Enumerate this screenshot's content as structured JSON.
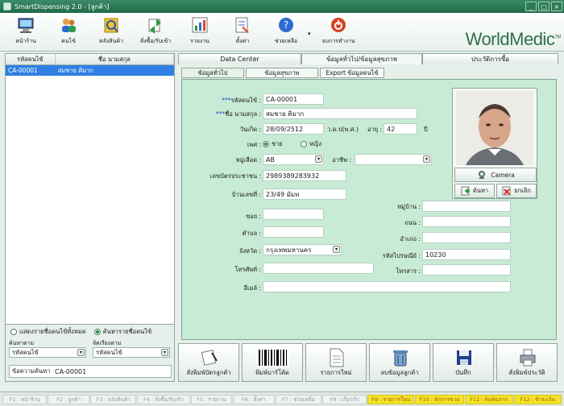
{
  "window": {
    "title": "SmartDispensing 2.0  -  [ลูกค้า]"
  },
  "toolbar": {
    "items": [
      {
        "label": "หน้าร้าน",
        "icon": "computer-icon"
      },
      {
        "label": "คนไข้",
        "icon": "people-icon"
      },
      {
        "label": "คลังสินค้า",
        "icon": "warehouse-icon"
      },
      {
        "label": "สั่งซื้อ/รับเข้า",
        "icon": "reorder-icon"
      },
      {
        "label": "รายงาน",
        "icon": "report-icon"
      },
      {
        "label": "ตั้งค่า",
        "icon": "settings-icon"
      },
      {
        "label": "ช่วยเหลือ",
        "icon": "help-icon"
      },
      {
        "label": "จบการทำงาน",
        "icon": "power-icon"
      }
    ],
    "help_arrow": "▾"
  },
  "logo": {
    "text": "WorldMedic",
    "tm": "TM"
  },
  "patient_list": {
    "col_code": "รหัสคนไข้",
    "col_name": "ชื่อ นามสกุล",
    "rows": [
      {
        "code": "CA-00001",
        "name": "สมชาย คิมาก"
      }
    ]
  },
  "left_filters": {
    "show_all": "แสดงรายชื่อคนไข้ทั้งหมด",
    "search_name": "ค้นหารายชื่อคนไข้",
    "search_by_label": "ค้นหาตาม",
    "search_by_value": "รหัสคนไข้",
    "sort_by_label": "จัดเรียงตาม",
    "sort_by_value": "รหัสคนไข้",
    "search_text_label": "ข้อความค้นหา",
    "search_text_value": "CA-00001"
  },
  "tabs": {
    "top": [
      "Data Center",
      "ข้อมูลทั่วไป/ข้อมูลสุขภาพ",
      "ประวัติการซื้อ"
    ],
    "sub": [
      "ข้อมูลทั่วไป",
      "ข้อมูลสุขภาพ",
      "Export ข้อมูลคนไข้"
    ]
  },
  "form": {
    "code_stars": "***",
    "code_label": "รหัสคนไข้ :",
    "code_value": "CA-00001",
    "name_stars": "***",
    "name_label": "ชื่อ นามสกุล :",
    "name_value": "สมชาย คิมาก",
    "dob_label": "วันเกิด :",
    "dob_value": "28/09/2512",
    "dob_format": "ว.ด.ป(พ.ศ.)",
    "age_label": "อายุ :",
    "age_value": "42",
    "age_unit": "ปี",
    "sex_label": "เพศ :",
    "sex_male": "ชาย",
    "sex_female": "หญิง",
    "blood_label": "หมู่เลือด :",
    "blood_value": "AB",
    "occupation_label": "อาชีพ :",
    "occupation_value": "",
    "idcard_label": "เลขบัตรประชาชน :",
    "idcard_value": "2989389283932",
    "house_label": "บ้านเลขที่ :",
    "house_value": "23/49 มัมท",
    "moo_label": "หมู่บ้าน :",
    "moo_value": "",
    "soi_label": "ซอย :",
    "soi_value": "",
    "road_label": "ถนน :",
    "road_value": "",
    "tambon_label": "ตำบล :",
    "tambon_value": "",
    "amphoe_label": "อำเภอ :",
    "amphoe_value": "",
    "province_label": "จังหวัด :",
    "province_value": "กรุงเทพมหานคร",
    "postcode_label": "รหัสไปรษณีย์ :",
    "postcode_value": "10230",
    "phone_label": "โทรศัพท์ :",
    "phone_value": "",
    "fax_label": "โทรสาร :",
    "fax_value": "",
    "email_label": "อีเมล์ :",
    "email_value": ""
  },
  "photo": {
    "camera_label": "Camera",
    "search_label": "ค้นหา",
    "delete_label": "ยกเลิก"
  },
  "bottom_buttons": [
    {
      "label": "สั่งพิมพ์บัตรลูกค้า",
      "icon": "print-card-icon"
    },
    {
      "label": "พิมพ์บาร์โค้ด",
      "icon": "barcode-icon"
    },
    {
      "label": "รายการใหม่",
      "icon": "new-document-icon"
    },
    {
      "label": "ลบข้อมูลลูกค้า",
      "icon": "delete-bin-icon"
    },
    {
      "label": "บันทึก",
      "icon": "save-disk-icon"
    },
    {
      "label": "สั่งพิมพ์ประวัติ",
      "icon": "printer-icon"
    }
  ],
  "status_keys": [
    {
      "label": "F1 : หน้าร้าน",
      "active": false
    },
    {
      "label": "F2 : ลูกค้า",
      "active": false
    },
    {
      "label": "F3 : คลังสินค้า",
      "active": false
    },
    {
      "label": "F4 : สั่งซื้อ/รับเข้า",
      "active": false
    },
    {
      "label": "F5 : รายงาน",
      "active": false
    },
    {
      "label": "F6 : ตั้งค่า",
      "active": false
    },
    {
      "label": "F7 : ช่วยเหลือ",
      "active": false
    },
    {
      "label": "F8 : เกี่ยวกับ",
      "active": false
    },
    {
      "label": "F9 : รายการใหม่",
      "active": true
    },
    {
      "label": "F10 : พักการขาย",
      "active": true
    },
    {
      "label": "F11 : พิมพ์ฉลาก",
      "active": true
    },
    {
      "label": "F12 : ชำระเงิน",
      "active": true
    }
  ],
  "colors": {
    "accent": "#2f7fe4",
    "title_bar": "#2a7a56",
    "form_bg": "#c7ebd4",
    "highlight_key": "#f2e32a"
  }
}
